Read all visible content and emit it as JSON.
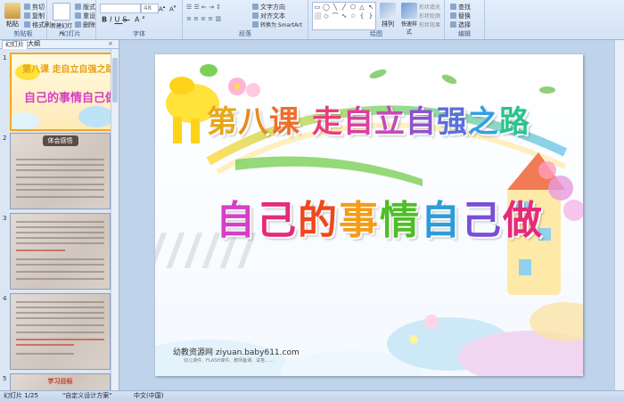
{
  "ribbon": {
    "clipboard": {
      "paste": "粘贴",
      "cut": "剪切",
      "copy": "复制",
      "format_painter": "格式刷",
      "label": "剪贴板"
    },
    "slides": {
      "new_slide": "新建幻灯片",
      "layout": "版式",
      "reset": "重设",
      "delete": "删除",
      "label": "幻灯片"
    },
    "font": {
      "font_name": "",
      "font_size": "48",
      "label": "字体"
    },
    "paragraph": {
      "text_direction": "文字方向",
      "align_text": "对齐文本",
      "smartart": "转换为 SmartArt",
      "label": "段落"
    },
    "drawing": {
      "arrange": "排列",
      "quick_styles": "快速样式",
      "shape_fill": "形状填充",
      "shape_outline": "形状轮廓",
      "shape_effects": "形状效果",
      "label": "绘图"
    },
    "editing": {
      "find": "查找",
      "replace": "替换",
      "select": "选择",
      "label": "编辑"
    }
  },
  "panel": {
    "tab_slides": "幻灯片",
    "tab_outline": "大纲",
    "thumb1": {
      "number": "1",
      "line1": "第八课 走自立自强之路",
      "line2": "自己的事情自己做"
    },
    "thumb2": {
      "number": "2",
      "title": "体会感悟"
    },
    "thumb3": {
      "number": "3"
    },
    "thumb4": {
      "number": "4"
    },
    "thumb5": {
      "number": "5",
      "title": "学习目标"
    }
  },
  "slide": {
    "title_line1": "第八课 走自立自强之路",
    "title_line2": "自己的事情自己做",
    "footer": "幼教资源网 ziyuan.baby611.com",
    "footer_small": "幼儿课件、FLASH课件、教师备课、试卷……"
  },
  "colors": {
    "title1": [
      "#e6a817",
      "#e98a1d",
      "#ef6e2e",
      "#e93e7b",
      "#dc3e9f",
      "#c54ab8",
      "#8d52d1",
      "#5b6de0",
      "#34a0df",
      "#2bc38e"
    ],
    "title2": [
      "#d63fc6",
      "#e52b7a",
      "#f0471e",
      "#f59b16",
      "#4fbe27",
      "#2d9cdb",
      "#7a4fd6",
      "#e52b7a"
    ]
  },
  "status": {
    "slide_info": "幻灯片 1/25",
    "theme": "\"自定义设计方案\"",
    "language": "中文(中国)"
  }
}
